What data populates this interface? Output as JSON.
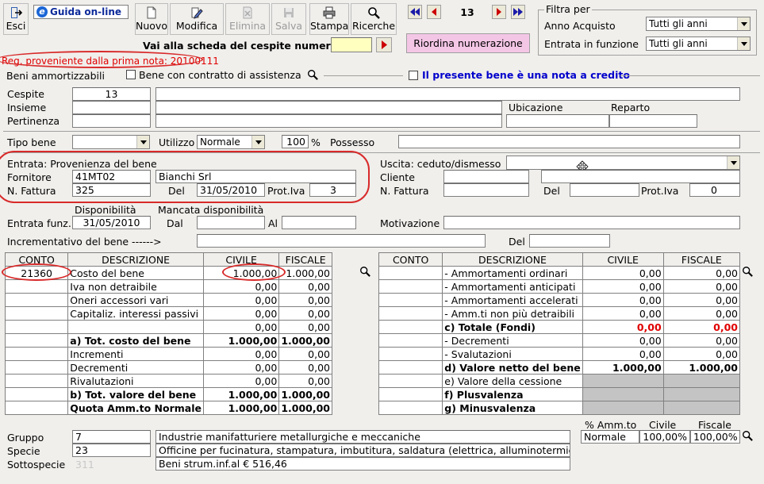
{
  "toolbar": {
    "esci": "Esci",
    "guida": "Guida on-line",
    "nuovo": "Nuovo",
    "modifica": "Modifica",
    "elimina": "Elimina",
    "salva": "Salva",
    "stampa": "Stampa",
    "ricerche": "Ricerche",
    "record_number": "13",
    "goto_label": "Vai alla scheda del cespite numero:",
    "goto_value": "",
    "riordina": "Riordina numerazione"
  },
  "filtro": {
    "title": "Filtra per",
    "anno_label": "Anno Acquisto",
    "anno_value": "Tutti gli anni",
    "entrata_label": "Entrata in funzione",
    "entrata_value": "Tutti gli anni"
  },
  "reg_note": "Reg. proveniente dalla prima nota: 20100111",
  "beni_label": "Beni ammortizzabili",
  "contratto_label": "Bene con contratto di assistenza",
  "nota_credito_label": "Il presente bene è una nota a credito",
  "cespite": {
    "cespite_label": "Cespite",
    "cespite_value": "13",
    "cespite_desc": "",
    "insieme_label": "Insieme",
    "pertinenza_label": "Pertinenza",
    "ubicazione_label": "Ubicazione",
    "reparto_label": "Reparto"
  },
  "tipo": {
    "tipo_label": "Tipo bene",
    "tipo_value": "",
    "utilizzo_label": "Utilizzo",
    "utilizzo_value": "Normale",
    "perc_value": "100",
    "perc_sign": "%",
    "possesso_label": "Possesso"
  },
  "entrata": {
    "title": "Entrata: Provenienza del bene",
    "fornitore_label": "Fornitore",
    "fornitore_code": "41MT02",
    "fornitore_name": "Bianchi Srl",
    "fattura_label": "N. Fattura",
    "fattura_value": "325",
    "del_label": "Del",
    "del_value": "31/05/2010",
    "prot_label": "Prot.Iva",
    "prot_value": "3"
  },
  "uscita": {
    "title": "Uscita: ceduto/dismesso",
    "cliente_label": "Cliente",
    "fattura_label": "N. Fattura",
    "del_label": "Del",
    "prot_label": "Prot.Iva",
    "prot_value": "0"
  },
  "disp": {
    "disponibilita_label": "Disponibilità",
    "mancata_label": "Mancata disponibilità",
    "entrata_funz_label": "Entrata funz.",
    "entrata_funz_value": "31/05/2010",
    "dal_label": "Dal",
    "al_label": "Al",
    "motivazione_label": "Motivazione",
    "incrementativo_label": "Incrementativo del bene ------>",
    "del_label": "Del"
  },
  "left_table": {
    "headers": [
      "CONTO",
      "DESCRIZIONE",
      "CIVILE",
      "FISCALE"
    ],
    "rows": [
      {
        "conto": "21360",
        "desc": "Costo del bene",
        "civile": "1.000,00",
        "fiscale": "1.000,00",
        "bold": false
      },
      {
        "conto": "",
        "desc": "Iva non detraibile",
        "civile": "0,00",
        "fiscale": "0,00",
        "bold": false
      },
      {
        "conto": "",
        "desc": "Oneri accessori vari",
        "civile": "0,00",
        "fiscale": "0,00",
        "bold": false
      },
      {
        "conto": "",
        "desc": "Capitaliz. interessi passivi",
        "civile": "0,00",
        "fiscale": "0,00",
        "bold": false
      },
      {
        "conto": "",
        "desc": "",
        "civile": "0,00",
        "fiscale": "0,00",
        "bold": false
      },
      {
        "conto": "",
        "desc": "a) Tot. costo del bene",
        "civile": "1.000,00",
        "fiscale": "1.000,00",
        "bold": true
      },
      {
        "conto": "",
        "desc": "Incrementi",
        "civile": "0,00",
        "fiscale": "0,00",
        "bold": false
      },
      {
        "conto": "",
        "desc": "Decrementi",
        "civile": "0,00",
        "fiscale": "0,00",
        "bold": false
      },
      {
        "conto": "",
        "desc": "Rivalutazioni",
        "civile": "0,00",
        "fiscale": "0,00",
        "bold": false
      },
      {
        "conto": "",
        "desc": "b) Tot. valore del bene",
        "civile": "1.000,00",
        "fiscale": "1.000,00",
        "bold": true
      },
      {
        "conto": "",
        "desc": "Quota Amm.to Normale",
        "civile": "1.000,00",
        "fiscale": "1.000,00",
        "bold": true
      }
    ]
  },
  "right_table": {
    "headers": [
      "CONTO",
      "DESCRIZIONE",
      "CIVILE",
      "FISCALE"
    ],
    "rows": [
      {
        "conto": "",
        "desc": "- Ammortamenti ordinari",
        "civile": "0,00",
        "fiscale": "0,00",
        "bold": false,
        "red": false,
        "grey": false
      },
      {
        "conto": "",
        "desc": "- Ammortamenti anticipati",
        "civile": "0,00",
        "fiscale": "0,00",
        "bold": false,
        "red": false,
        "grey": false
      },
      {
        "conto": "",
        "desc": "- Ammortamenti accelerati",
        "civile": "0,00",
        "fiscale": "0,00",
        "bold": false,
        "red": false,
        "grey": false
      },
      {
        "conto": "",
        "desc": "- Amm.ti non più detraibili",
        "civile": "0,00",
        "fiscale": "0,00",
        "bold": false,
        "red": false,
        "grey": false
      },
      {
        "conto": "",
        "desc": "c) Totale (Fondi)",
        "civile": "0,00",
        "fiscale": "0,00",
        "bold": true,
        "red": true,
        "grey": false
      },
      {
        "conto": "",
        "desc": "- Decrementi",
        "civile": "0,00",
        "fiscale": "0,00",
        "bold": false,
        "red": false,
        "grey": false
      },
      {
        "conto": "",
        "desc": "- Svalutazioni",
        "civile": "0,00",
        "fiscale": "0,00",
        "bold": false,
        "red": false,
        "grey": false
      },
      {
        "conto": "",
        "desc": "d) Valore netto del bene",
        "civile": "1.000,00",
        "fiscale": "1.000,00",
        "bold": true,
        "red": false,
        "grey": false
      },
      {
        "conto": "",
        "desc": "e) Valore della cessione",
        "civile": "",
        "fiscale": "",
        "bold": false,
        "red": false,
        "grey": true
      },
      {
        "conto": "",
        "desc": "f) Plusvalenza",
        "civile": "",
        "fiscale": "",
        "bold": true,
        "red": false,
        "grey": true
      },
      {
        "conto": "",
        "desc": "g) Minusvalenza",
        "civile": "",
        "fiscale": "",
        "bold": true,
        "red": false,
        "grey": true
      }
    ]
  },
  "classif": {
    "gruppo_label": "Gruppo",
    "gruppo_code": "7",
    "gruppo_desc": "Industrie manifatturiere metallurgiche e meccaniche",
    "specie_label": "Specie",
    "specie_code": "23",
    "specie_desc": "Officine per fucinatura, stampatura, imbutitura, saldatura (elettrica, alluminotermica",
    "sottospecie_label": "Sottospecie",
    "sottospecie_code": "311",
    "sottospecie_desc": "Beni strum.inf.al € 516,46"
  },
  "amm": {
    "perc_label": "% Amm.to",
    "civile_label": "Civile",
    "fiscale_label": "Fiscale",
    "tipo_value": "Normale",
    "civile_value": "100,00%",
    "fiscale_value": "100,00%"
  },
  "colors": {
    "highlight": "#d82a2a",
    "pink_button": "#f4c6e6",
    "goto_field": "#ffffc0",
    "nav_blue": "#1a1aa8",
    "nav_red": "#cc0000",
    "link_blue": "#0000cc"
  }
}
